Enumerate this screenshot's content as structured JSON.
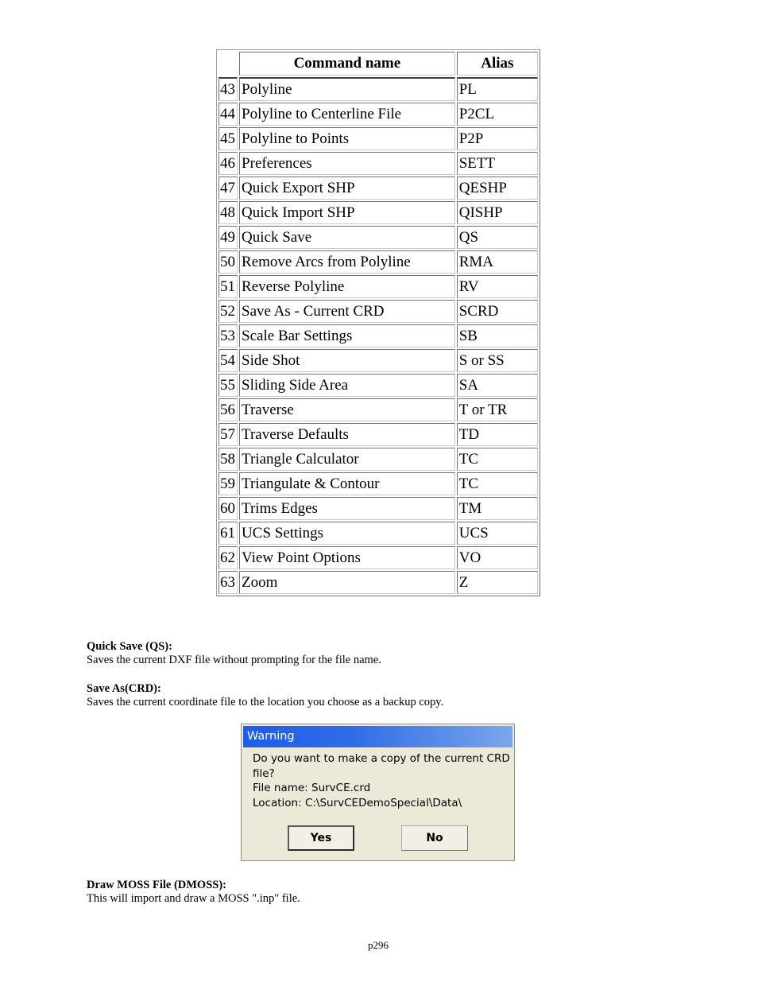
{
  "table": {
    "headers": {
      "index": "",
      "command": "Command name",
      "alias": "Alias"
    },
    "rows": [
      {
        "num": "43",
        "name": "Polyline",
        "alias": "PL"
      },
      {
        "num": "44",
        "name": "Polyline to Centerline File",
        "alias": "P2CL"
      },
      {
        "num": "45",
        "name": "Polyline to Points",
        "alias": "P2P"
      },
      {
        "num": "46",
        "name": "Preferences",
        "alias": "SETT"
      },
      {
        "num": "47",
        "name": "Quick Export SHP",
        "alias": "QESHP"
      },
      {
        "num": "48",
        "name": "Quick Import SHP",
        "alias": "QISHP"
      },
      {
        "num": "49",
        "name": "Quick Save",
        "alias": "QS"
      },
      {
        "num": "50",
        "name": "Remove Arcs from Polyline",
        "alias": "RMA"
      },
      {
        "num": "51",
        "name": "Reverse Polyline",
        "alias": "RV"
      },
      {
        "num": "52",
        "name": "Save As - Current CRD",
        "alias": "SCRD"
      },
      {
        "num": "53",
        "name": "Scale Bar Settings",
        "alias": "SB"
      },
      {
        "num": "54",
        "name": "Side Shot",
        "alias": "S or SS"
      },
      {
        "num": "55",
        "name": "Sliding Side Area",
        "alias": "SA"
      },
      {
        "num": "56",
        "name": "Traverse",
        "alias": "T or TR"
      },
      {
        "num": "57",
        "name": "Traverse Defaults",
        "alias": "TD"
      },
      {
        "num": "58",
        "name": "Triangle Calculator",
        "alias": "TC"
      },
      {
        "num": "59",
        "name": "Triangulate & Contour",
        "alias": "TC"
      },
      {
        "num": "60",
        "name": "Trims Edges",
        "alias": "TM"
      },
      {
        "num": "61",
        "name": "UCS Settings",
        "alias": "UCS"
      },
      {
        "num": "62",
        "name": "View Point Options",
        "alias": "VO"
      },
      {
        "num": "63",
        "name": "Zoom",
        "alias": "Z"
      }
    ]
  },
  "sections": {
    "quick_save": {
      "heading": "Quick Save (QS):",
      "body": "Saves the current DXF file without prompting for the file name."
    },
    "save_as": {
      "heading": "Save As(CRD):",
      "body": "Saves the current coordinate file to the location you choose as a backup copy."
    },
    "draw_moss": {
      "heading": "Draw MOSS File (DMOSS):",
      "body": "This will import and draw a MOSS \".inp\" file."
    }
  },
  "dialog": {
    "title": "Warning",
    "lines": [
      "Do you want to make a copy of the current CRD",
      "file?",
      "File name: SurvCE.crd",
      "Location: C:\\SurvCEDemoSpecial\\Data\\"
    ],
    "yes_label": "Yes",
    "no_label": "No",
    "title_color": "#2f6ce8",
    "background_color": "#ece9d8"
  },
  "footer": {
    "page_number": "p296"
  }
}
